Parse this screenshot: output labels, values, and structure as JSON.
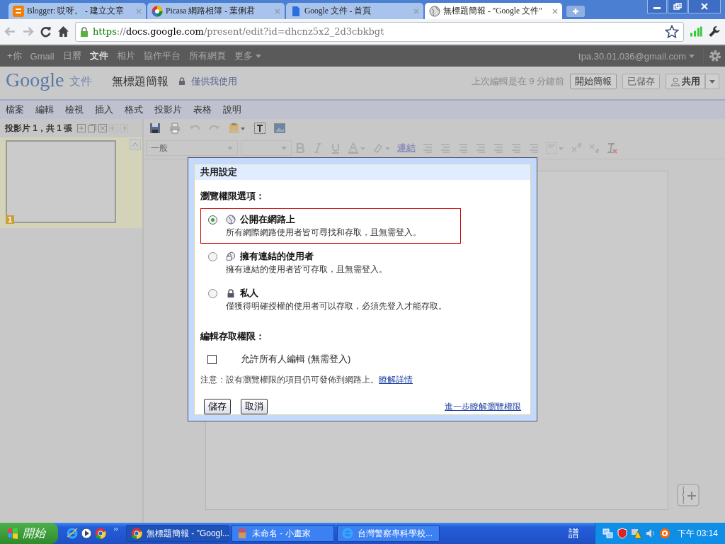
{
  "browser": {
    "tabs": [
      {
        "kind": "blogger",
        "title": "Blogger: 哎呀。 - 建立文章",
        "selected": false
      },
      {
        "kind": "picasa",
        "title": "Picasa 網路相簿 - 葉俐君",
        "selected": false
      },
      {
        "kind": "docs",
        "title": "Google 文件 - 首頁",
        "selected": false
      },
      {
        "kind": "globe",
        "title": "無標題簡報 - \"Google 文件\"",
        "selected": true
      }
    ],
    "url": {
      "scheme": "https",
      "rest_scheme": "://",
      "host": "docs.google.com",
      "path": "/present/edit?id=dhcnz5x2_2d3cbkbgt"
    }
  },
  "google_bar": {
    "links": [
      {
        "label": "+你",
        "selected": false
      },
      {
        "label": "Gmail",
        "selected": false
      },
      {
        "label": "日曆",
        "selected": false
      },
      {
        "label": "文件",
        "selected": true
      },
      {
        "label": "相片",
        "selected": false
      },
      {
        "label": "協作平台",
        "selected": false
      },
      {
        "label": "所有網頁",
        "selected": false
      }
    ],
    "more": "更多",
    "account": "tpa.30.01.036@gmail.com"
  },
  "docs_header": {
    "logo": "Google",
    "product": "文件",
    "title": "無標題簡報",
    "visibility": "僅供我使用",
    "last_edit": "上次編輯是在 9 分鐘前",
    "buttons": [
      "開始簡報",
      "已儲存"
    ],
    "share": "共用"
  },
  "menu": [
    "檔案",
    "編輯",
    "檢視",
    "插入",
    "格式",
    "投影片",
    "表格",
    "說明"
  ],
  "slides_panel": {
    "label": "投影片 1，共 1 張",
    "thumbnail_number": "1"
  },
  "format_toolbar": {
    "style": "一般",
    "link": "連結"
  },
  "dialog": {
    "title": "共用設定",
    "view_heading": "瀏覽權限選項：",
    "options": [
      {
        "kind": "public",
        "label": "公開在網路上",
        "description": "所有網際網路使用者皆可尋找和存取，且無需登入。",
        "selected": true
      },
      {
        "kind": "link",
        "label": "擁有連結的使用者",
        "description": "擁有連結的使用者皆可存取，且無需登入。",
        "selected": false
      },
      {
        "kind": "private",
        "label": "私人",
        "description": "僅獲得明確授權的使用者可以存取，必須先登入才能存取。",
        "selected": false
      }
    ],
    "edit_heading": "編輯存取權限：",
    "allow_edit": {
      "label": "允許所有人編輯 (無需登入)",
      "checked": false
    },
    "note": "注意：設有瀏覽權限的項目仍可發佈到網路上。",
    "note_link": "瞭解詳情",
    "buttons": [
      "儲存",
      "取消"
    ],
    "more_link": "進一步瞭解瀏覽權限"
  },
  "taskbar": {
    "start": "開始",
    "tasks": [
      {
        "kind": "chrome",
        "title": "無標題簡報 - \"Googl..."
      },
      {
        "kind": "paint",
        "title": "未命名 - 小畫家"
      },
      {
        "kind": "ie",
        "title": "台灣警察專科學校..."
      }
    ],
    "ime": "譜",
    "clock": "下午 03:14"
  }
}
